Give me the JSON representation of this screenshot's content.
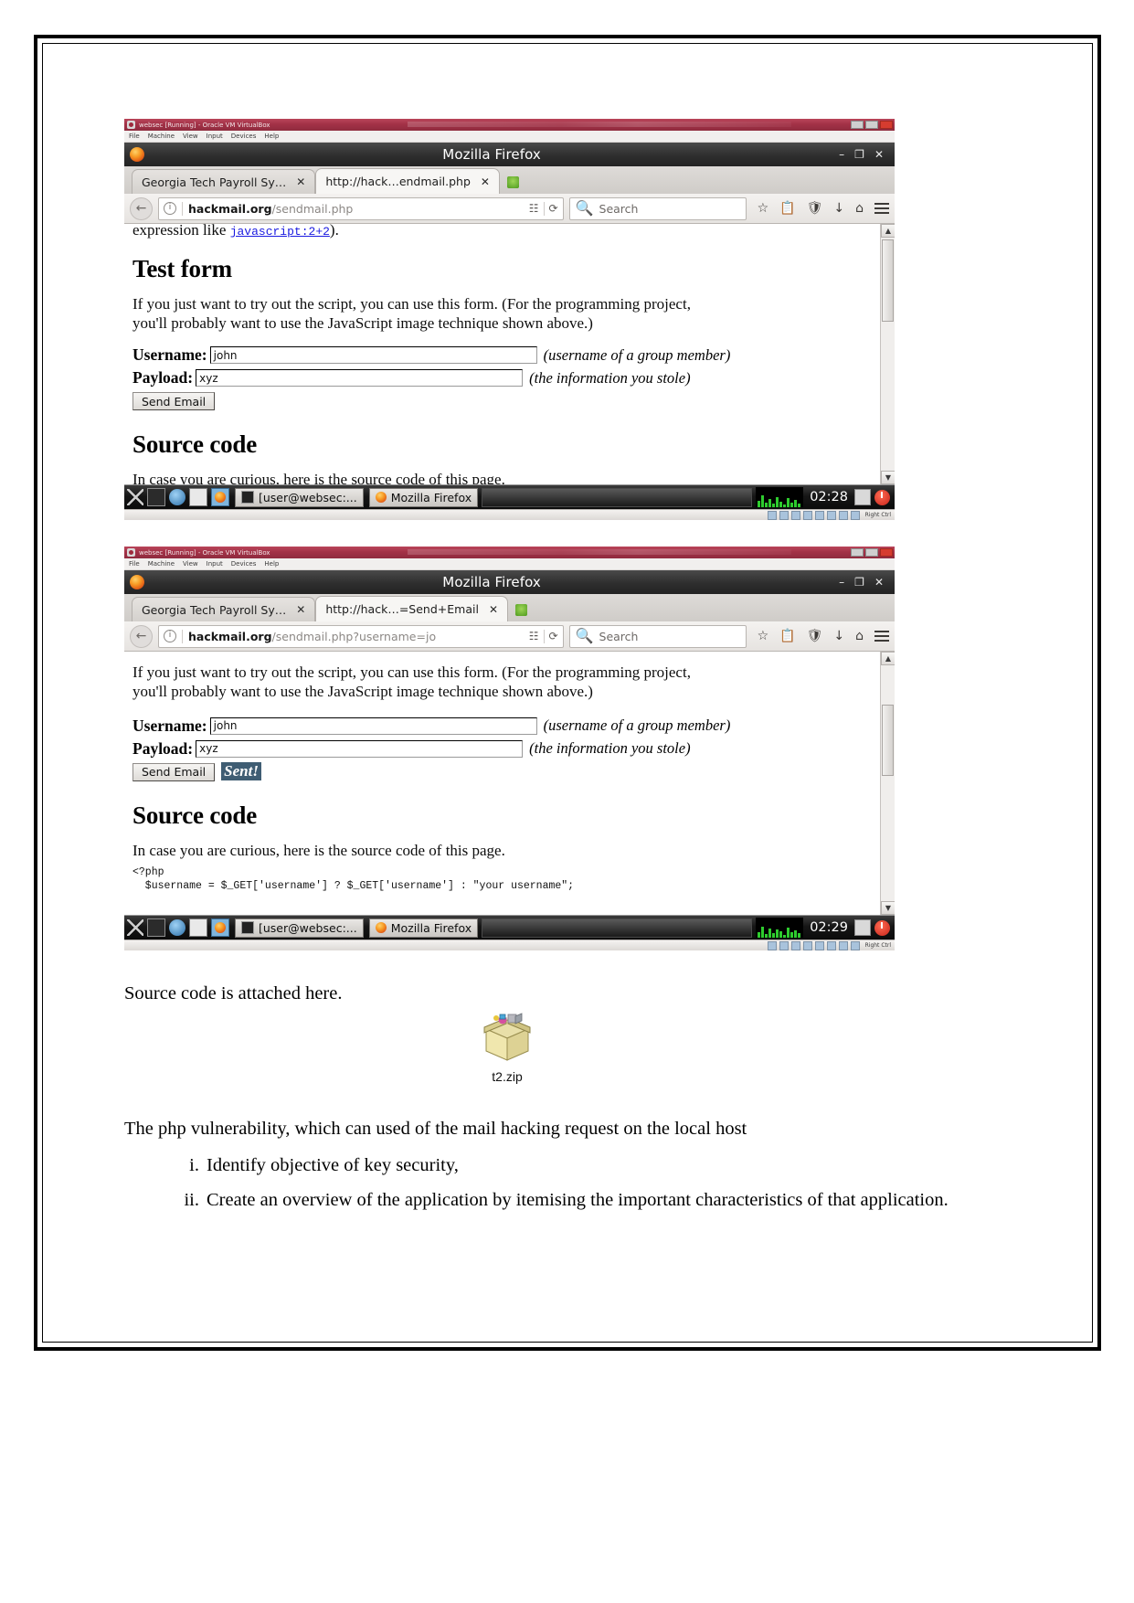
{
  "document": {
    "caption_source": "Source code is attached here.",
    "attachment_label": "t2.zip",
    "paragraph": "The php vulnerability, which can used of the mail hacking request on the local host",
    "list": [
      {
        "marker": "i.",
        "text": "Identify objective of key security,"
      },
      {
        "marker": "ii.",
        "text": "Create an overview of the application by itemising the important characteristics of that application."
      }
    ]
  },
  "screenshots": [
    {
      "id": "shot-1",
      "vm": {
        "title": "websec [Running] - Oracle VM VirtualBox",
        "menu": [
          "File",
          "Machine",
          "View",
          "Input",
          "Devices",
          "Help"
        ]
      },
      "browser": {
        "window_title": "Mozilla Firefox",
        "window_controls": {
          "minimize": "–",
          "maximize": "❐",
          "close": "✕"
        },
        "tabs": [
          {
            "label": "Georgia Tech Payroll Sy…",
            "close": "✕",
            "active": false
          },
          {
            "label": "http://hack…endmail.php",
            "close": "✕",
            "active": true
          }
        ],
        "new_tab_icon": "new-tab-icon",
        "back_icon": "←",
        "url_host": "hackmail.org",
        "url_path": "/sendmail.php",
        "reader_icon": "reader-view-icon",
        "reload_icon": "⟳",
        "search_placeholder": "Search",
        "search_icon": "search-icon",
        "toolbar_icons": [
          "star-icon",
          "clipboard-icon",
          "shield-icon",
          "download-icon",
          "home-icon",
          "menu-icon"
        ]
      },
      "page": {
        "top_fragment_pre": "expression like ",
        "top_fragment_code": "javascript:2+2",
        "top_fragment_post": ").",
        "heading_test_form": "Test form",
        "intro_line1": "If you just want to try out the script, you can use this form. (For the programming project,",
        "intro_line2": "you'll probably want to use the JavaScript image technique shown above.)",
        "username_label": "Username:",
        "username_value": "john",
        "username_hint": "(username of a group member)",
        "payload_label": "Payload:",
        "payload_value": "xyz",
        "payload_hint": "(the information you stole)",
        "send_button": "Send Email",
        "heading_source_code": "Source code",
        "source_intro": "In case you are curious, here is the source code of this page."
      },
      "taskbar": {
        "terminal_task": "[user@websec:...",
        "firefox_task": "Mozilla Firefox",
        "clock": "02:28"
      },
      "statusbar": {
        "text": "Right Ctrl"
      }
    },
    {
      "id": "shot-2",
      "vm": {
        "title": "websec [Running] - Oracle VM VirtualBox",
        "menu": [
          "File",
          "Machine",
          "View",
          "Input",
          "Devices",
          "Help"
        ]
      },
      "browser": {
        "window_title": "Mozilla Firefox",
        "window_controls": {
          "minimize": "–",
          "maximize": "❐",
          "close": "✕"
        },
        "tabs": [
          {
            "label": "Georgia Tech Payroll Sy…",
            "close": "✕",
            "active": false
          },
          {
            "label": "http://hack…=Send+Email",
            "close": "✕",
            "active": true
          }
        ],
        "new_tab_icon": "new-tab-icon",
        "back_icon": "←",
        "url_host": "hackmail.org",
        "url_path": "/sendmail.php?username=jo",
        "reader_icon": "reader-view-icon",
        "reload_icon": "⟳",
        "search_placeholder": "Search",
        "search_icon": "search-icon",
        "toolbar_icons": [
          "star-icon",
          "clipboard-icon",
          "shield-icon",
          "download-icon",
          "home-icon",
          "menu-icon"
        ]
      },
      "page": {
        "intro_line1": "If you just want to try out the script, you can use this form. (For the programming project,",
        "intro_line2": "you'll probably want to use the JavaScript image technique shown above.)",
        "username_label": "Username:",
        "username_value": "john",
        "username_hint": "(username of a group member)",
        "payload_label": "Payload:",
        "payload_value": "xyz",
        "payload_hint": "(the information you stole)",
        "send_button": "Send Email",
        "sent_badge": "Sent!",
        "heading_source_code": "Source code",
        "source_intro": "In case you are curious, here is the source code of this page.",
        "code_line1": "<?php",
        "code_line2": "  $username = $_GET['username'] ? $_GET['username'] : \"your username\";"
      },
      "taskbar": {
        "terminal_task": "[user@websec:...",
        "firefox_task": "Mozilla Firefox",
        "clock": "02:29"
      },
      "statusbar": {
        "text": "Right Ctrl"
      }
    }
  ]
}
